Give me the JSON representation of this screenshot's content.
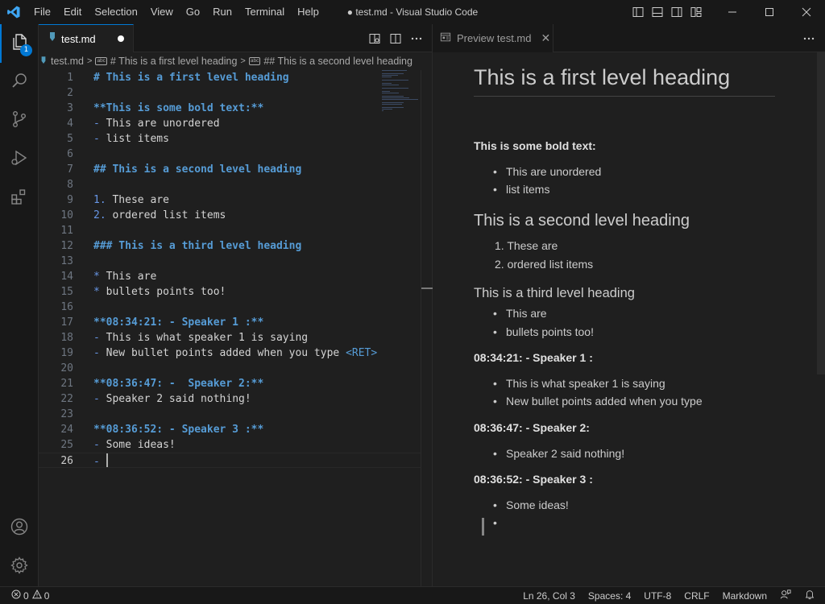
{
  "window": {
    "title": "● test.md - Visual Studio Code",
    "menu": [
      "File",
      "Edit",
      "Selection",
      "View",
      "Go",
      "Run",
      "Terminal",
      "Help"
    ],
    "accent": "#0078d4"
  },
  "activity_bar": {
    "items": [
      {
        "icon": "files-icon",
        "badge": "1"
      },
      {
        "icon": "search-icon"
      },
      {
        "icon": "source-control-icon"
      },
      {
        "icon": "run-debug-icon"
      },
      {
        "icon": "extensions-icon"
      }
    ],
    "bottom": [
      {
        "icon": "account-icon"
      },
      {
        "icon": "gear-icon"
      }
    ]
  },
  "editor": {
    "tab": {
      "label": "test.md",
      "dirty": true
    },
    "breadcrumb": [
      "test.md",
      "# This is a first level heading",
      "## This is a second level heading"
    ],
    "lines": [
      {
        "n": "1",
        "parts": [
          {
            "c": "h",
            "t": "# This is a first level heading"
          }
        ]
      },
      {
        "n": "2",
        "parts": []
      },
      {
        "n": "3",
        "parts": [
          {
            "c": "b",
            "t": "**This is some bold text:**"
          }
        ]
      },
      {
        "n": "4",
        "parts": [
          {
            "c": "p",
            "t": "- "
          },
          {
            "c": "t",
            "t": "This are unordered"
          }
        ]
      },
      {
        "n": "5",
        "parts": [
          {
            "c": "p",
            "t": "- "
          },
          {
            "c": "t",
            "t": "list items"
          }
        ]
      },
      {
        "n": "6",
        "parts": []
      },
      {
        "n": "7",
        "parts": [
          {
            "c": "h",
            "t": "## This is a second level heading"
          }
        ]
      },
      {
        "n": "8",
        "parts": []
      },
      {
        "n": "9",
        "parts": [
          {
            "c": "p",
            "t": "1. "
          },
          {
            "c": "t",
            "t": "These are"
          }
        ]
      },
      {
        "n": "10",
        "parts": [
          {
            "c": "p",
            "t": "2. "
          },
          {
            "c": "t",
            "t": "ordered list items"
          }
        ]
      },
      {
        "n": "11",
        "parts": []
      },
      {
        "n": "12",
        "parts": [
          {
            "c": "h",
            "t": "### This is a third level heading"
          }
        ]
      },
      {
        "n": "13",
        "parts": []
      },
      {
        "n": "14",
        "parts": [
          {
            "c": "p",
            "t": "* "
          },
          {
            "c": "t",
            "t": "This are"
          }
        ]
      },
      {
        "n": "15",
        "parts": [
          {
            "c": "p",
            "t": "* "
          },
          {
            "c": "t",
            "t": "bullets points too!"
          }
        ]
      },
      {
        "n": "16",
        "parts": []
      },
      {
        "n": "17",
        "parts": [
          {
            "c": "b",
            "t": "**08:34:21: - Speaker 1 :**"
          }
        ]
      },
      {
        "n": "18",
        "parts": [
          {
            "c": "p",
            "t": "- "
          },
          {
            "c": "t",
            "t": "This is what speaker 1 is saying"
          }
        ]
      },
      {
        "n": "19",
        "parts": [
          {
            "c": "p",
            "t": "- "
          },
          {
            "c": "t",
            "t": "New bullet points added when you type "
          },
          {
            "c": "ret",
            "t": "<RET>"
          }
        ]
      },
      {
        "n": "20",
        "parts": []
      },
      {
        "n": "21",
        "parts": [
          {
            "c": "b",
            "t": "**08:36:47: -  Speaker 2:**"
          }
        ]
      },
      {
        "n": "22",
        "parts": [
          {
            "c": "p",
            "t": "- "
          },
          {
            "c": "t",
            "t": "Speaker 2 said nothing!"
          }
        ]
      },
      {
        "n": "23",
        "parts": []
      },
      {
        "n": "24",
        "parts": [
          {
            "c": "b",
            "t": "**08:36:52: - Speaker 3 :**"
          }
        ]
      },
      {
        "n": "25",
        "parts": [
          {
            "c": "p",
            "t": "- "
          },
          {
            "c": "t",
            "t": "Some ideas!"
          }
        ]
      },
      {
        "n": "26",
        "parts": [
          {
            "c": "p",
            "t": "- "
          }
        ],
        "current": true
      }
    ]
  },
  "preview": {
    "tab": {
      "label": "Preview test.md"
    },
    "h1": "This is a first level heading",
    "bold1": "This is some bold text:",
    "ul1": [
      "This are unordered",
      "list items"
    ],
    "h2": "This is a second level heading",
    "ol": [
      "These are",
      "ordered list items"
    ],
    "h3": "This is a third level heading",
    "ul2": [
      "This are",
      "bullets points too!"
    ],
    "s1": "08:34:21: - Speaker 1 :",
    "s1_items": [
      "This is what speaker 1 is saying",
      "New bullet points added when you type"
    ],
    "s2": "08:36:47: - Speaker 2:",
    "s2_items": [
      "Speaker 2 said nothing!"
    ],
    "s3": "08:36:52: - Speaker 3 :",
    "s3_items": [
      "Some ideas!"
    ]
  },
  "status": {
    "errors": "0",
    "warnings": "0",
    "position": "Ln 26, Col 3",
    "spaces": "Spaces: 4",
    "encoding": "UTF-8",
    "eol": "CRLF",
    "language": "Markdown"
  }
}
